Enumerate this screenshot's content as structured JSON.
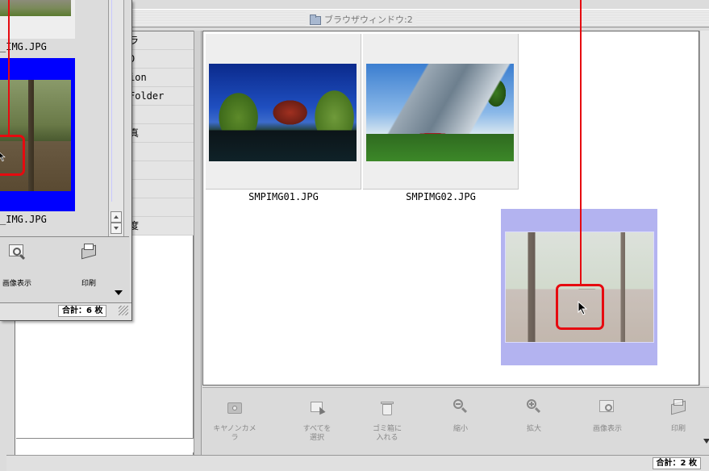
{
  "window2": {
    "title": "ブラウザウィンドウ:2",
    "left_list_items": [
      "ラ",
      "D",
      "ion",
      "Folder",
      "",
      "真",
      "",
      "",
      "",
      "",
      "度"
    ],
    "thumbnails": [
      {
        "filename": "SMPIMG01.JPG"
      },
      {
        "filename": "SMPIMG02.JPG"
      }
    ],
    "toolbar": [
      {
        "label": "キヤノンカメラ",
        "icon": "camera-icon"
      },
      {
        "label": "すべてを\n選択",
        "icon": "select-all-icon"
      },
      {
        "label": "ゴミ箱に\n入れる",
        "icon": "trash-icon"
      },
      {
        "label": "縮小",
        "icon": "zoom-out-icon"
      },
      {
        "label": "拡大",
        "icon": "zoom-in-icon"
      },
      {
        "label": "画像表示",
        "icon": "view-image-icon"
      },
      {
        "label": "印刷",
        "icon": "print-icon"
      }
    ],
    "status_count": "合計：2 枚"
  },
  "window1": {
    "labels": [
      "_IMG.JPG",
      "_IMG.JPG"
    ],
    "toolbar": [
      {
        "label": "画像表示",
        "icon": "view-image-icon"
      },
      {
        "label": "印刷",
        "icon": "print-icon"
      }
    ],
    "status_count": "合計：6 枚"
  },
  "colors": {
    "selection_blue": "#0000ff",
    "selection_lavender": "#b3b3f0",
    "highlight_red": "#e60a10"
  }
}
